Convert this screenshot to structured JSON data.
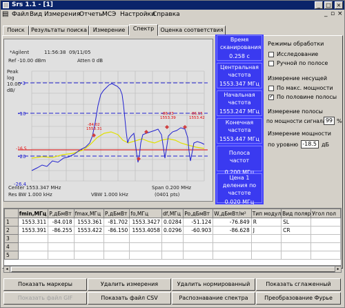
{
  "window": {
    "title": "Srs 1.1 - [1]",
    "min": "_",
    "max": "□",
    "close": "×"
  },
  "menu": [
    "Файл",
    "Вид",
    "Измерения",
    "Отчеты",
    "МСЭ",
    "Настройки",
    "Справка"
  ],
  "tabs": [
    "Поиск",
    "Результаты поиска",
    "Измерение",
    "Спектр",
    "Оценка соответствия"
  ],
  "active_tab": "Спектр",
  "analyzer": {
    "brand": "*Agilent",
    "time": "11:56:38",
    "date": "09/11/05",
    "ref": "Ref -10.00 dBm",
    "atten": "Atten 0 dB",
    "peak": "Peak",
    "log": "log",
    "scale_val": "10.00",
    "scale_unit": "dB/",
    "center": "Center 1553.347 MHz",
    "span": "Span 0.200 MHz",
    "res_bw": "Res BW 1.000 kHz",
    "vbw": "VBW 1.000 kHz",
    "points": "(0401 pts)",
    "y_ticks": [
      "-3",
      "-10",
      "-16.5",
      "-20",
      "-26.4"
    ],
    "marker_labels": [
      {
        "a": "-84.02",
        "b": "1553.31"
      },
      {
        "a": "-86.23",
        "b": "1553.39"
      },
      {
        "a": "-86.15",
        "b": "1553.42"
      }
    ],
    "colors": {
      "trace": "#2020d0",
      "yellow": "#e0e000",
      "red": "#e00000",
      "marker": "#d04040"
    }
  },
  "info": [
    {
      "label": "Время сканирования",
      "value": "0.258 с"
    },
    {
      "label": "Центральная частота",
      "value": "1553.347 МГц"
    },
    {
      "label": "Начальная частота",
      "value": "1553.247 МГц"
    },
    {
      "label": "Конечная частота",
      "value": "1553.447 МГц"
    },
    {
      "label": "Полоса частот",
      "value": "0.200 МГц"
    },
    {
      "label": "Цена 1 деления по частоте",
      "value": "0.020 МГц"
    }
  ],
  "settings": {
    "modes_title": "Режимы обработки",
    "mode_explore": "Исследование",
    "mode_manual": "Ручной по полосе",
    "carrier_title": "Измерение несущей",
    "carrier_max": "По макс. мощности",
    "carrier_half": "По половине полосы",
    "band_title": "Измерение полосы",
    "band_label": "по мощности сигнала",
    "band_value": "99",
    "band_unit": "%",
    "power_title": "Измерение мощности",
    "power_label": "по уровню",
    "power_value": "-18.5",
    "power_unit": "дБ"
  },
  "table": {
    "columns": [
      "fmin,МГц",
      "P,дБмВт",
      "fmax,МГц",
      "P,дБмВт",
      "fo,МГц",
      "df,МГц",
      "Po,дБмВт",
      "W,дБмВт/м²",
      "Тип модул",
      "Вид поляр",
      "Угол пол"
    ],
    "rows": [
      [
        "1",
        "1553.311",
        "-84.018",
        "1553.361",
        "-81.702",
        "1553.3427",
        "0.0284",
        "-51.124",
        "-76.849",
        "R",
        "SL",
        ""
      ],
      [
        "2",
        "1553.391",
        "-86.255",
        "1553.422",
        "-86.150",
        "1553.4058",
        "0.0296",
        "-60.903",
        "-86.628",
        "J",
        "CR",
        ""
      ],
      [
        "3",
        "",
        "",
        "",
        "",
        "",
        "",
        "",
        "",
        "",
        "",
        ""
      ],
      [
        "4",
        "",
        "",
        "",
        "",
        "",
        "",
        "",
        "",
        "",
        "",
        ""
      ],
      [
        "5",
        "",
        "",
        "",
        "",
        "",
        "",
        "",
        "",
        "",
        "",
        ""
      ]
    ]
  },
  "buttons": {
    "show_markers": "Показать маркеры",
    "delete_meas": "Удалить измерения",
    "delete_norm": "Удалить нормированный",
    "show_smooth": "Показать сглаженный",
    "show_gif": "Показать файл GIF",
    "show_csv": "Показать файл CSV",
    "recognize": "Распознавание спектра",
    "fourier": "Преобразование Фурье"
  }
}
